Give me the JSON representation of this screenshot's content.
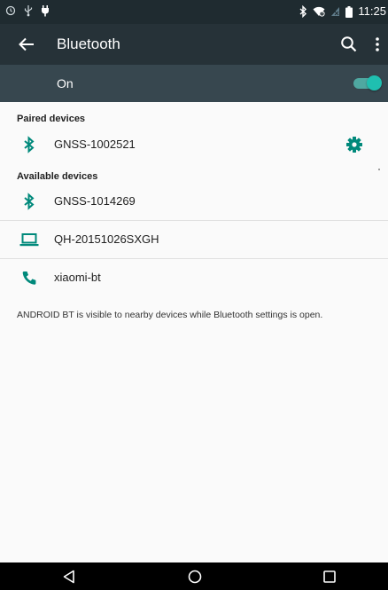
{
  "status_bar": {
    "time": "11:25",
    "left_icons": [
      "alarm-icon",
      "usb-icon",
      "charging-icon"
    ],
    "right_icons": [
      "bluetooth-icon",
      "wifi-icon",
      "no-sim-icon",
      "battery-icon"
    ]
  },
  "toolbar": {
    "title": "Bluetooth"
  },
  "master_switch": {
    "label": "On",
    "checked": true,
    "accent": "#1fbfb0"
  },
  "paired": {
    "header": "Paired devices",
    "devices": [
      {
        "name": "GNSS-1002521",
        "icon": "bluetooth-icon"
      }
    ]
  },
  "available": {
    "header": "Available devices",
    "devices": [
      {
        "name": "GNSS-1014269",
        "icon": "bluetooth-icon"
      },
      {
        "name": "QH-20151026SXGH",
        "icon": "laptop-icon"
      },
      {
        "name": "xiaomi-bt",
        "icon": "phone-icon"
      }
    ]
  },
  "footer": {
    "text": "ANDROID BT is visible to nearby devices while Bluetooth settings is open."
  },
  "colors": {
    "status_bar": "#1f2b30",
    "toolbar": "#263238",
    "switch_bar": "#37474f",
    "icon_teal": "#00897b"
  }
}
